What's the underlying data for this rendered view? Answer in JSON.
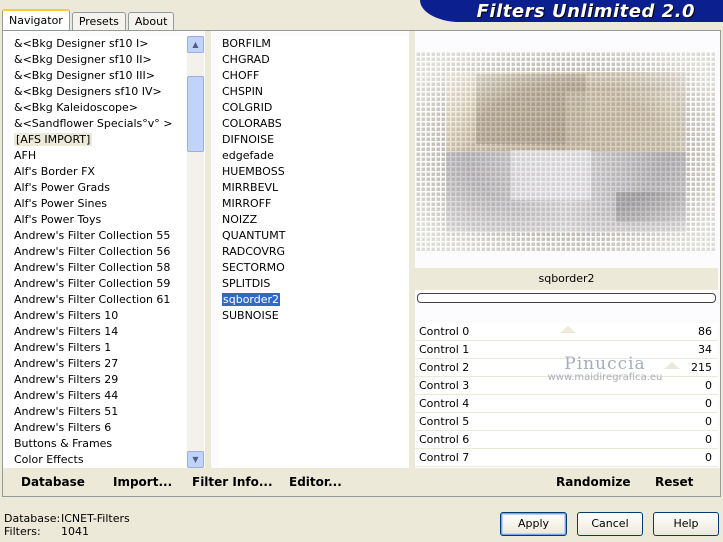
{
  "tabs": [
    {
      "label": "Navigator",
      "active": true
    },
    {
      "label": "Presets",
      "active": false
    },
    {
      "label": "About",
      "active": false
    }
  ],
  "title": "Filters Unlimited 2.0",
  "categories": [
    {
      "label": "&<Bkg Designer sf10 I>"
    },
    {
      "label": "&<Bkg Designer sf10 II>"
    },
    {
      "label": "&<Bkg Designer sf10 III>"
    },
    {
      "label": "&<Bkg Designers sf10 IV>"
    },
    {
      "label": "&<Bkg Kaleidoscope>"
    },
    {
      "label": "&<Sandflower Specials°v° >"
    },
    {
      "label": "[AFS IMPORT]",
      "current": true
    },
    {
      "label": "AFH"
    },
    {
      "label": "Alf's Border FX"
    },
    {
      "label": "Alf's Power Grads"
    },
    {
      "label": "Alf's Power Sines"
    },
    {
      "label": "Alf's Power Toys"
    },
    {
      "label": "Andrew's Filter Collection 55"
    },
    {
      "label": "Andrew's Filter Collection 56"
    },
    {
      "label": "Andrew's Filter Collection 58"
    },
    {
      "label": "Andrew's Filter Collection 59"
    },
    {
      "label": "Andrew's Filter Collection 61"
    },
    {
      "label": "Andrew's Filters 10"
    },
    {
      "label": "Andrew's Filters 14"
    },
    {
      "label": "Andrew's Filters 1"
    },
    {
      "label": "Andrew's Filters 27"
    },
    {
      "label": "Andrew's Filters 29"
    },
    {
      "label": "Andrew's Filters 44"
    },
    {
      "label": "Andrew's Filters 51"
    },
    {
      "label": "Andrew's Filters 6"
    },
    {
      "label": "Buttons & Frames"
    },
    {
      "label": "Color Effects"
    }
  ],
  "filters": [
    {
      "label": "BORFILM"
    },
    {
      "label": "CHGRAD"
    },
    {
      "label": "CHOFF"
    },
    {
      "label": "CHSPIN"
    },
    {
      "label": "COLGRID"
    },
    {
      "label": "COLORABS"
    },
    {
      "label": "DIFNOISE"
    },
    {
      "label": "edgefade"
    },
    {
      "label": "HUEMBOSS"
    },
    {
      "label": "MIRRBEVL"
    },
    {
      "label": "MIRROFF"
    },
    {
      "label": "NOIZZ"
    },
    {
      "label": "QUANTUMT"
    },
    {
      "label": "RADCOVRG"
    },
    {
      "label": "SECTORMO"
    },
    {
      "label": "SPLITDIS"
    },
    {
      "label": "sqborder2",
      "selected": true
    },
    {
      "label": "SUBNOISE"
    }
  ],
  "selected_filter_name": "sqborder2",
  "controls": [
    {
      "label": "Control 0",
      "value": "86"
    },
    {
      "label": "Control 1",
      "value": "34"
    },
    {
      "label": "Control 2",
      "value": "215"
    },
    {
      "label": "Control 3",
      "value": "0"
    },
    {
      "label": "Control 4",
      "value": "0"
    },
    {
      "label": "Control 5",
      "value": "0"
    },
    {
      "label": "Control 6",
      "value": "0"
    },
    {
      "label": "Control 7",
      "value": "0"
    }
  ],
  "toolbar": {
    "database": "Database",
    "import": "Import...",
    "filter_info": "Filter Info...",
    "editor": "Editor...",
    "randomize": "Randomize",
    "reset": "Reset"
  },
  "watermark": {
    "name": "Pinuccia",
    "url": "www.maidiregrafica.eu"
  },
  "status": {
    "database_label": "Database:",
    "database_value": "ICNET-Filters",
    "filters_label": "Filters:",
    "filters_value": "1041"
  },
  "buttons": {
    "apply": "Apply",
    "cancel": "Cancel",
    "help": "Help"
  },
  "colors": {
    "banner": "#0b1f8f",
    "selection": "#316ac5",
    "tab_accent": "#ffc83c"
  }
}
